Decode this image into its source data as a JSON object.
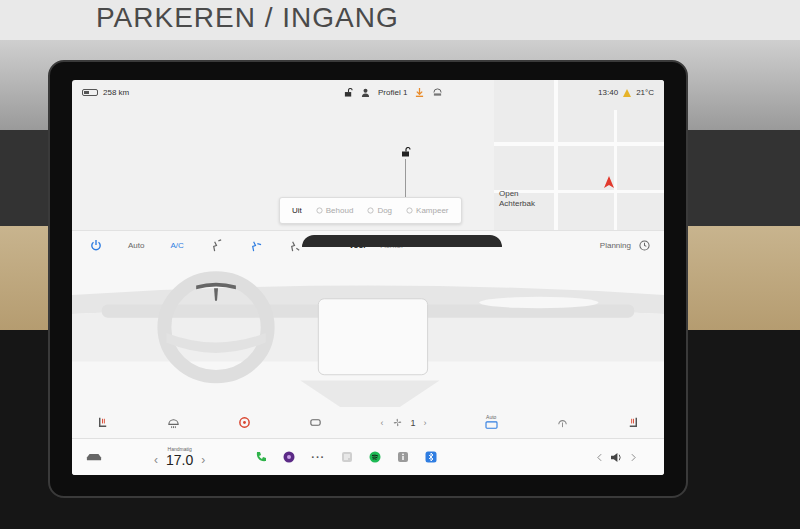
{
  "backdrop": {
    "sign": "PARKEREN / INGANG"
  },
  "status_bar": {
    "range": "258 km",
    "battery_level": 0.4,
    "profile": "Profiel 1",
    "time": "13:40",
    "temperature": "21°C"
  },
  "car_view": {
    "locked": false,
    "trunk_label": [
      "Open",
      "Achterbak"
    ]
  },
  "climate_modes": [
    {
      "label": "Uit",
      "selected": true
    },
    {
      "label": "Behoud",
      "selected": false
    },
    {
      "label": "Dog",
      "selected": false
    },
    {
      "label": "Kampeer",
      "selected": false
    }
  ],
  "climate": {
    "power_on": true,
    "auto": {
      "label": "Auto",
      "on": false
    },
    "ac": {
      "label": "A/C",
      "on": true
    },
    "airflow": [
      {
        "selected": false
      },
      {
        "selected": true
      },
      {
        "selected": false
      }
    ],
    "zones": [
      {
        "label": "Voor",
        "selected": true
      },
      {
        "label": "Achter",
        "selected": false
      }
    ],
    "planning": "Planning",
    "fan_left": "‹",
    "fan_speed": "1",
    "fan_right": "›",
    "rear_defrost_label": "Auto"
  },
  "dock": {
    "mode_label": "Handmatig",
    "temp_left": "‹",
    "temperature": "17.0",
    "temp_right": "›",
    "more": "···",
    "apps": [
      {
        "kind": "phone",
        "color": "#2fb34a"
      },
      {
        "kind": "camera",
        "color": "#5b2a86"
      },
      {
        "kind": "more",
        "color": "#555555"
      },
      {
        "kind": "notes",
        "color": "#cfcfcf"
      },
      {
        "kind": "spotify",
        "color": "#1db954"
      },
      {
        "kind": "info",
        "color": "#9a9a9a"
      },
      {
        "kind": "bluetooth",
        "color": "#2f7de1"
      }
    ]
  }
}
